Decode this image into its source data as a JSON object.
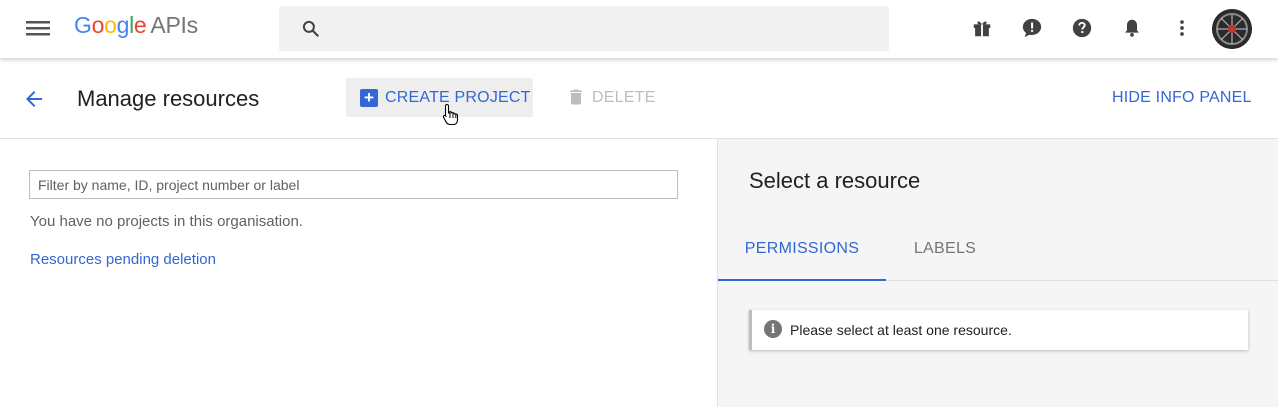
{
  "app": {
    "logo_brand": "Google",
    "logo_product": "APIs",
    "brand_colors": {
      "blue": "#4285F4",
      "red": "#EA4335",
      "yellow": "#FBBC05",
      "green": "#34A853"
    }
  },
  "topbar": {
    "search_placeholder": "",
    "icons": [
      "menu-icon",
      "search-icon",
      "gift-icon",
      "feedback-icon",
      "help-icon",
      "notifications-icon",
      "more-vert-icon",
      "avatar"
    ]
  },
  "header": {
    "title": "Manage resources",
    "create_label": "CREATE PROJECT",
    "delete_label": "DELETE",
    "hide_info_label": "HIDE INFO PANEL"
  },
  "main": {
    "filter_placeholder": "Filter by name, ID, project number or label",
    "empty_message": "You have no projects in this organisation.",
    "pending_link": "Resources pending deletion"
  },
  "info_panel": {
    "title": "Select a resource",
    "tabs": [
      {
        "label": "PERMISSIONS",
        "active": true
      },
      {
        "label": "LABELS",
        "active": false
      }
    ],
    "message": "Please select at least one resource."
  },
  "colors": {
    "accent": "#3367d6",
    "disabled": "#bdbdbd",
    "panel_bg": "#f5f5f5"
  }
}
